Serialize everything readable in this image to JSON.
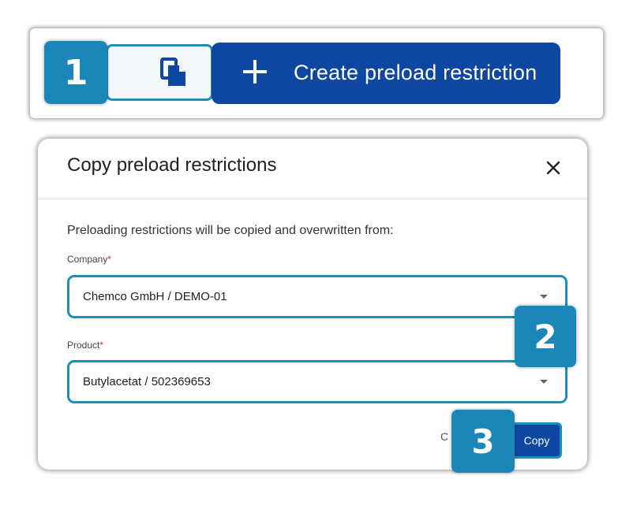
{
  "toolbar": {
    "copy_icon": "copy-icon",
    "create_icon": "plus-icon",
    "create_label": "Create preload restriction"
  },
  "badges": {
    "step1": "1",
    "step2": "2",
    "step3": "3"
  },
  "dialog": {
    "title": "Copy preload restrictions",
    "close_icon": "close-icon",
    "intro": "Preloading restrictions will be copied and overwritten from:",
    "company": {
      "label": "Company",
      "required_mark": "*",
      "value": "Chemco GmbH / DEMO-01"
    },
    "product": {
      "label": "Product",
      "required_mark": "*",
      "value": "Butylacetat / 502369653"
    },
    "cancel_label": "C",
    "copy_label": "Copy"
  },
  "colors": {
    "primary": "#0d47a1",
    "highlight": "#1c8fb8",
    "badge": "#1b86b8",
    "required": "#d32f2f"
  }
}
